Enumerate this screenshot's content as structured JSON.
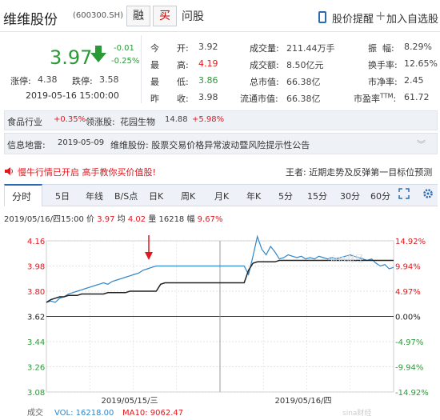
{
  "header": {
    "stock_name": "维维股份",
    "stock_code": "(600300.SH)",
    "btn_rong": "融",
    "btn_mai": "买",
    "link_wengu": "问股",
    "alert_label": "股价提醒",
    "add_watch_label": "加入自选股",
    "icons": {
      "alert": "phone-icon",
      "add": "plus-icon"
    }
  },
  "quote": {
    "price": "3.97",
    "change": "-0.01",
    "change_pct": "-0.25%",
    "limit_up_label": "涨停:",
    "limit_up": "4.38",
    "limit_down_label": "跌停:",
    "limit_down": "3.58",
    "timestamp": "2019-05-16 15:00:00",
    "grid": {
      "today": {
        "c1": "今",
        "c2": "开:",
        "value": "3.92"
      },
      "high": {
        "c1": "最",
        "c2": "高:",
        "value": "4.19"
      },
      "low": {
        "c1": "最",
        "c2": "低:",
        "value": "3.86"
      },
      "prev": {
        "c1": "昨",
        "c2": "收:",
        "value": "3.98"
      },
      "volume": {
        "label": "成交量:",
        "value": "211.44万手"
      },
      "amount": {
        "label": "成交额:",
        "value": "8.50亿元"
      },
      "mktcap": {
        "label": "总市值:",
        "value": "66.38亿"
      },
      "float_mktcap": {
        "label": "流通市值:",
        "value": "66.38亿"
      },
      "amplitude": {
        "label": "振  幅:",
        "value": "8.29%"
      },
      "turnover": {
        "label": "换手率:",
        "value": "12.65%"
      },
      "pb": {
        "label": "市净率:",
        "value": "2.45"
      },
      "pe": {
        "label": "市盈率",
        "sup": "TTM",
        "colon": ":",
        "value": "61.72"
      }
    },
    "colors": {
      "up": "#e0181f",
      "down": "#2a9a37"
    }
  },
  "industry": {
    "label": "食品行业",
    "pct": "+0.35%",
    "leader_label": "领涨股:",
    "leader_name": "花园生物",
    "leader_price": "14.88",
    "leader_pct": "+5.98%"
  },
  "info_mine": {
    "label": "信息地雷:",
    "date": "2019-05-09",
    "title": "维维股份: 股票交易价格异常波动暨风险提示性公告"
  },
  "promo": {
    "left": "慢牛行情已开启 高手教你买价值股!",
    "right": "王者: 近期走势及反弹第一目标位预测"
  },
  "tabs": [
    "分时",
    "5日",
    "年线",
    "B/S点",
    "日K",
    "周K",
    "月K",
    "年K",
    "5分",
    "15分",
    "30分",
    "60分"
  ],
  "chart_info": {
    "date": "2019/05/16/四15:00",
    "price_label": "价",
    "price": "3.97",
    "avg_label": "均",
    "avg": "4.02",
    "vol_label": "量",
    "vol": "16218",
    "amp_label": "幅",
    "amp": "9.67%"
  },
  "chart_data": {
    "type": "line",
    "x_labels": [
      "2019/05/15/三",
      "2019/05/16/四"
    ],
    "y_left": [
      "4.16",
      "3.98",
      "3.80",
      "3.62",
      "3.44",
      "3.26",
      "3.08"
    ],
    "y_right": [
      "14.92%",
      "9.94%",
      "4.97%",
      "0.00%",
      "-4.97%",
      "-9.94%",
      "-14.92%"
    ],
    "ylim": [
      3.08,
      4.16
    ],
    "grid": true,
    "series": [
      {
        "values": [
          3.72,
          3.73,
          3.72,
          3.75,
          3.76,
          3.78,
          3.79,
          3.8,
          3.81,
          3.82,
          3.83,
          3.84,
          3.85,
          3.86,
          3.85,
          3.87,
          3.88,
          3.89,
          3.9,
          3.91,
          3.92,
          3.93,
          3.95,
          3.96,
          3.97,
          3.98,
          3.98,
          3.98,
          3.98,
          3.98,
          3.98,
          3.98,
          3.98,
          3.98,
          3.98,
          3.98,
          3.98,
          3.98,
          3.98,
          3.98,
          3.98,
          3.98,
          3.98,
          3.98,
          3.98,
          3.98,
          3.92,
          4.05,
          4.19,
          4.1,
          4.06,
          4.12,
          4.08,
          4.03,
          4.04,
          4.06,
          4.05,
          4.04,
          4.05,
          4.03,
          4.04,
          4.03,
          4.05,
          4.04,
          4.03,
          4.04,
          4.03,
          4.04,
          4.05,
          4.06,
          4.05,
          4.04,
          4.03,
          4.02,
          4.03,
          4.0,
          3.98,
          3.99,
          3.96,
          3.97
        ]
      },
      {
        "values": [
          3.72,
          3.74,
          3.75,
          3.76,
          3.76,
          3.77,
          3.77,
          3.77,
          3.78,
          3.78,
          3.78,
          3.78,
          3.78,
          3.78,
          3.79,
          3.79,
          3.79,
          3.79,
          3.79,
          3.8,
          3.8,
          3.8,
          3.8,
          3.8,
          3.8,
          3.8,
          3.85,
          3.86,
          3.86,
          3.86,
          3.86,
          3.86,
          3.86,
          3.86,
          3.86,
          3.86,
          3.86,
          3.86,
          3.86,
          3.86,
          3.86,
          3.86,
          3.86,
          3.86,
          3.86,
          3.86,
          3.95,
          4.0,
          4.01,
          4.01,
          4.01,
          4.01,
          4.01,
          4.02,
          4.02,
          4.02,
          4.02,
          4.02,
          4.02,
          4.02,
          4.02,
          4.02,
          4.02,
          4.02,
          4.02,
          4.02,
          4.02,
          4.02,
          4.02,
          4.02,
          4.02,
          4.02,
          4.02,
          4.02,
          4.02,
          4.02,
          4.02,
          4.02,
          4.02,
          4.02
        ]
      }
    ],
    "colors": {
      "price_line": "#2f86c9",
      "avg_line": "#222222",
      "zero_line": "#333333",
      "up_axis": "#e0181f",
      "down_axis": "#2a9a37"
    },
    "volume_label": "成交",
    "volume_text": "VOL: 16218.00",
    "ma10_text": "MA10: 9062.47"
  }
}
